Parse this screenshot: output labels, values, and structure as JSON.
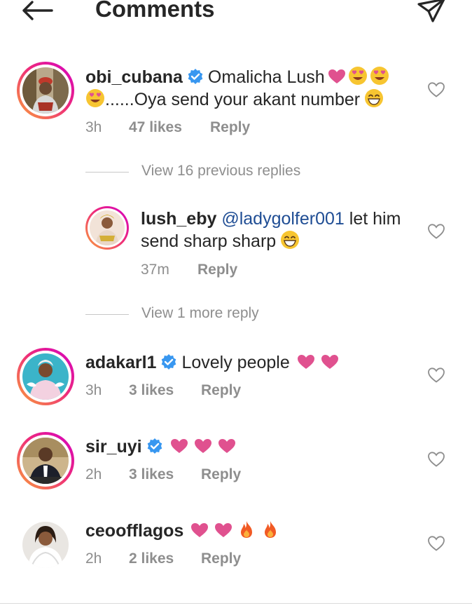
{
  "header": {
    "title": "Comments",
    "back_icon": "arrow-left-icon",
    "send_icon": "paper-plane-icon"
  },
  "comments": [
    {
      "username": "obi_cubana",
      "verified": true,
      "text_line1": "Omalicha Lush",
      "text_line2": "......Oya send your akant  number",
      "time": "3h",
      "likes": "47 likes",
      "reply": "Reply"
    },
    {
      "username": "lush_eby",
      "mention": "@ladygolfer001",
      "text_line1": " let him",
      "text_line2": "send sharp sharp",
      "time": "37m",
      "reply": "Reply"
    },
    {
      "username": "adakarl1",
      "verified": true,
      "text": "Lovely people",
      "time": "3h",
      "likes": "3 likes",
      "reply": "Reply"
    },
    {
      "username": "sir_uyi",
      "verified": true,
      "time": "2h",
      "likes": "3 likes",
      "reply": "Reply"
    },
    {
      "username": "ceoofflagos",
      "time": "2h",
      "likes": "2 likes",
      "reply": "Reply"
    }
  ],
  "view_previous_replies": "View 16 previous replies",
  "view_more_reply": "View 1 more reply",
  "colors": {
    "verified": "#3897f0",
    "heart": "#e0518f",
    "meta": "#8e8e8e",
    "mention": "#1f4d94"
  }
}
